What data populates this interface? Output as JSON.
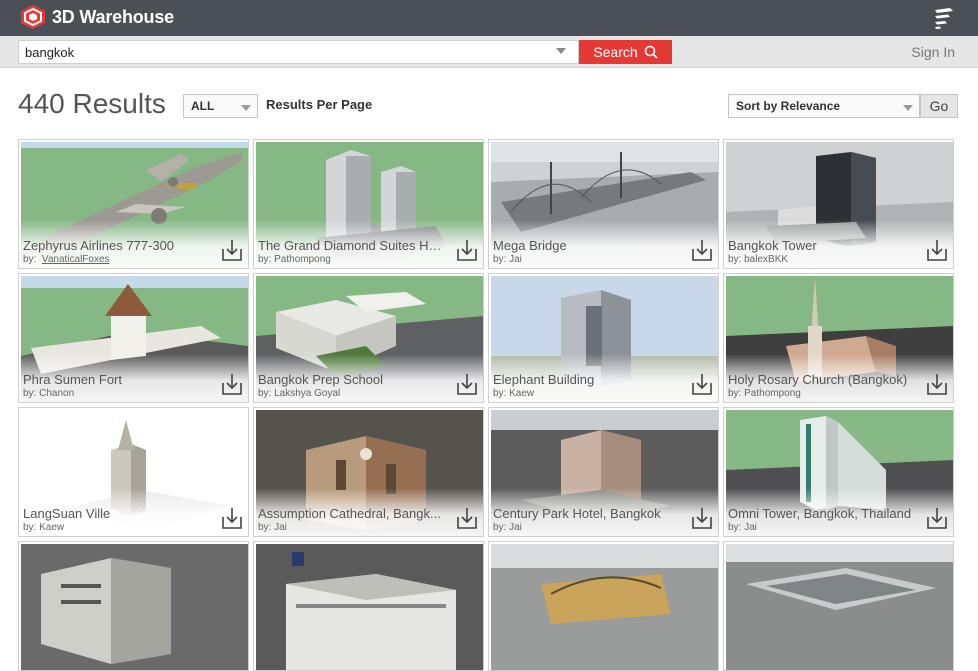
{
  "header": {
    "brand": "3D Warehouse",
    "logo_icon": "warehouse-logo-icon",
    "menu_icon": "hamburger-menu-icon"
  },
  "search": {
    "value": "bangkok",
    "button_label": "Search",
    "signin_label": "Sign In"
  },
  "results": {
    "title": "440 Results",
    "per_page_value": "ALL",
    "per_page_label": "Results Per Page",
    "sort_value": "Sort by Relevance",
    "go_label": "Go"
  },
  "colors": {
    "topbar": "#4b4f56",
    "accent": "#e53935",
    "ground": "#86b886"
  },
  "models": [
    {
      "title": "Zephyrus Airlines 777-300",
      "author": "VanaticalFoxes",
      "by": "by:",
      "thumb": "airplane"
    },
    {
      "title": "The Grand Diamond Suites Hotel",
      "author": "Pathompong",
      "by": "by:",
      "thumb": "twin-towers"
    },
    {
      "title": "Mega Bridge",
      "author": "Jai",
      "by": "by:",
      "thumb": "bridge"
    },
    {
      "title": "Bangkok Tower",
      "author": "balexBKK",
      "by": "by:",
      "thumb": "tower"
    },
    {
      "title": "Phra Sumen Fort",
      "author": "Chanon",
      "by": "by:",
      "thumb": "fort"
    },
    {
      "title": "Bangkok Prep School",
      "author": "Lakshya Goyal",
      "by": "by:",
      "thumb": "school"
    },
    {
      "title": "Elephant Building",
      "author": "Kaew",
      "by": "by:",
      "thumb": "elephant"
    },
    {
      "title": "Holy Rosary Church (Bangkok)",
      "author": "Pathompong",
      "by": "by:",
      "thumb": "church"
    },
    {
      "title": "LangSuan Ville",
      "author": "Kaew",
      "by": "by:",
      "thumb": "spire"
    },
    {
      "title": "Assumption Cathedral, Bangk...",
      "author": "Jai",
      "by": "by:",
      "thumb": "cathedral"
    },
    {
      "title": "Century Park Hotel, Bangkok",
      "author": "Jai",
      "by": "by:",
      "thumb": "hotel"
    },
    {
      "title": "Omni Tower, Bangkok, Thailand",
      "author": "Jai",
      "by": "by:",
      "thumb": "omni"
    },
    {
      "title": "",
      "author": "",
      "by": "",
      "thumb": "block"
    },
    {
      "title": "",
      "author": "",
      "by": "",
      "thumb": "corner"
    },
    {
      "title": "",
      "author": "",
      "by": "",
      "thumb": "station"
    },
    {
      "title": "",
      "author": "",
      "by": "",
      "thumb": "mall"
    }
  ]
}
